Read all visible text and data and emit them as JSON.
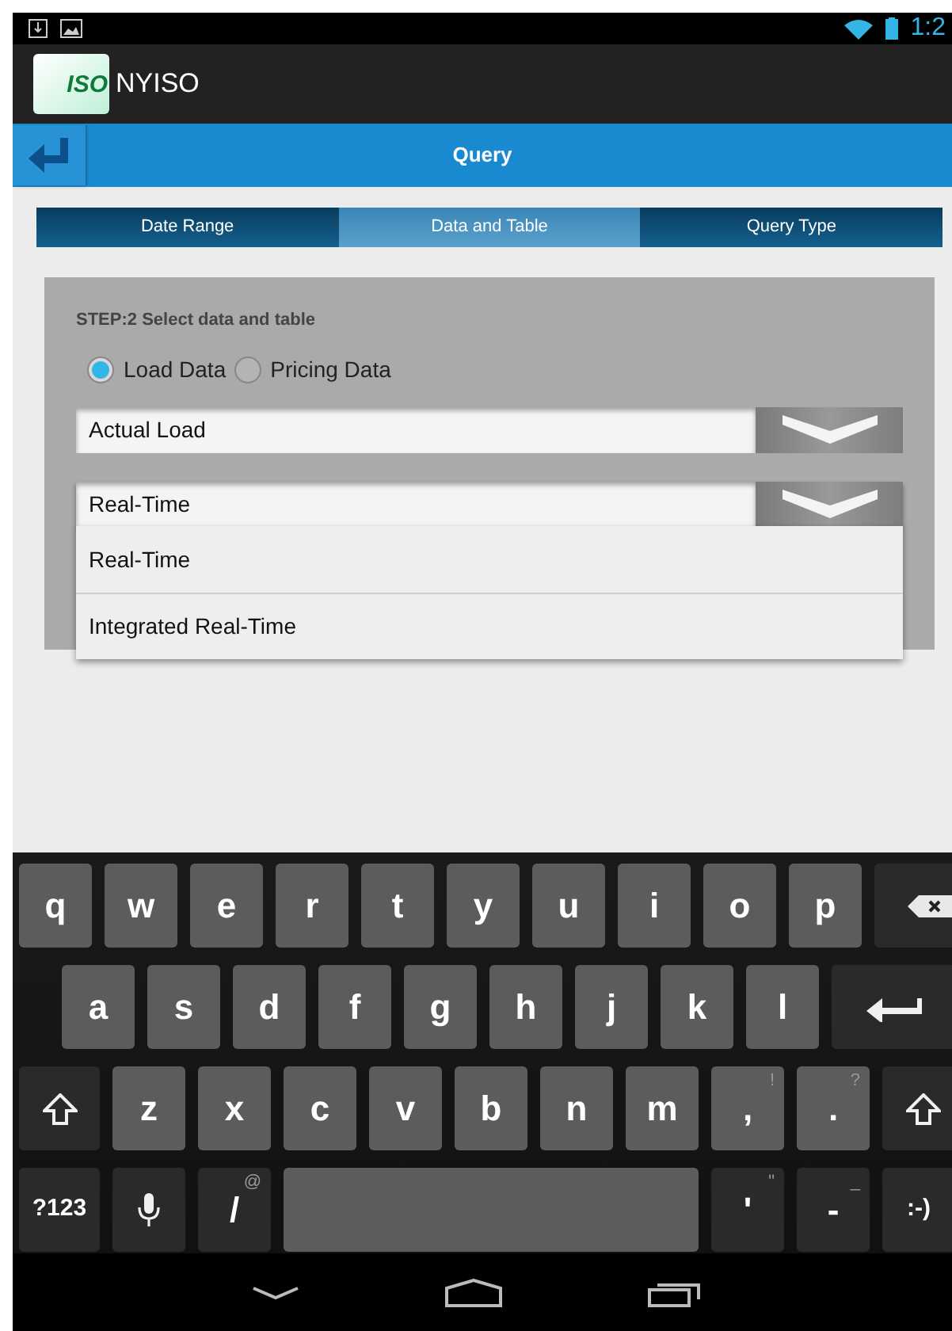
{
  "status_bar": {
    "time": "1:2"
  },
  "app_bar": {
    "logo_text": "ISO",
    "title": "NYISO"
  },
  "header": {
    "title": "Query"
  },
  "tabs": [
    {
      "label": "Date Range",
      "selected": false
    },
    {
      "label": "Data and Table",
      "selected": true
    },
    {
      "label": "Query Type",
      "selected": false
    }
  ],
  "step": {
    "title": "STEP:2 Select data and table",
    "options": [
      {
        "label": "Load Data",
        "selected": true
      },
      {
        "label": "Pricing Data",
        "selected": false
      }
    ],
    "dropdowns": [
      {
        "value": "Actual Load",
        "expanded": false
      },
      {
        "value": "Real-Time",
        "expanded": true
      }
    ]
  },
  "dropdown_menu": {
    "items": [
      {
        "label": "Real-Time"
      },
      {
        "label": "Integrated Real-Time"
      }
    ]
  },
  "keyboard": {
    "rows": [
      [
        {
          "kind": "letter",
          "label": "q"
        },
        {
          "kind": "letter",
          "label": "w"
        },
        {
          "kind": "letter",
          "label": "e"
        },
        {
          "kind": "letter",
          "label": "r"
        },
        {
          "kind": "letter",
          "label": "t"
        },
        {
          "kind": "letter",
          "label": "y"
        },
        {
          "kind": "letter",
          "label": "u"
        },
        {
          "kind": "letter",
          "label": "i"
        },
        {
          "kind": "letter",
          "label": "o"
        },
        {
          "kind": "letter",
          "label": "p"
        },
        {
          "kind": "backspace"
        }
      ],
      [
        {
          "kind": "letter",
          "label": "a"
        },
        {
          "kind": "letter",
          "label": "s"
        },
        {
          "kind": "letter",
          "label": "d"
        },
        {
          "kind": "letter",
          "label": "f"
        },
        {
          "kind": "letter",
          "label": "g"
        },
        {
          "kind": "letter",
          "label": "h"
        },
        {
          "kind": "letter",
          "label": "j"
        },
        {
          "kind": "letter",
          "label": "k"
        },
        {
          "kind": "letter",
          "label": "l"
        },
        {
          "kind": "enter"
        }
      ],
      [
        {
          "kind": "shift"
        },
        {
          "kind": "letter",
          "label": "z"
        },
        {
          "kind": "letter",
          "label": "x"
        },
        {
          "kind": "letter",
          "label": "c"
        },
        {
          "kind": "letter",
          "label": "v"
        },
        {
          "kind": "letter",
          "label": "b"
        },
        {
          "kind": "letter",
          "label": "n"
        },
        {
          "kind": "letter",
          "label": "m"
        },
        {
          "kind": "letter",
          "label": ",",
          "hint": "!"
        },
        {
          "kind": "letter",
          "label": ".",
          "hint": "?"
        },
        {
          "kind": "shift"
        }
      ],
      [
        {
          "kind": "function",
          "label": "?123"
        },
        {
          "kind": "mic"
        },
        {
          "kind": "function",
          "label": "/",
          "hint": "@"
        },
        {
          "kind": "space"
        },
        {
          "kind": "function",
          "label": "'",
          "hint": "\""
        },
        {
          "kind": "function",
          "label": "-",
          "hint": "_"
        },
        {
          "kind": "function",
          "label": ":-)"
        }
      ]
    ]
  }
}
